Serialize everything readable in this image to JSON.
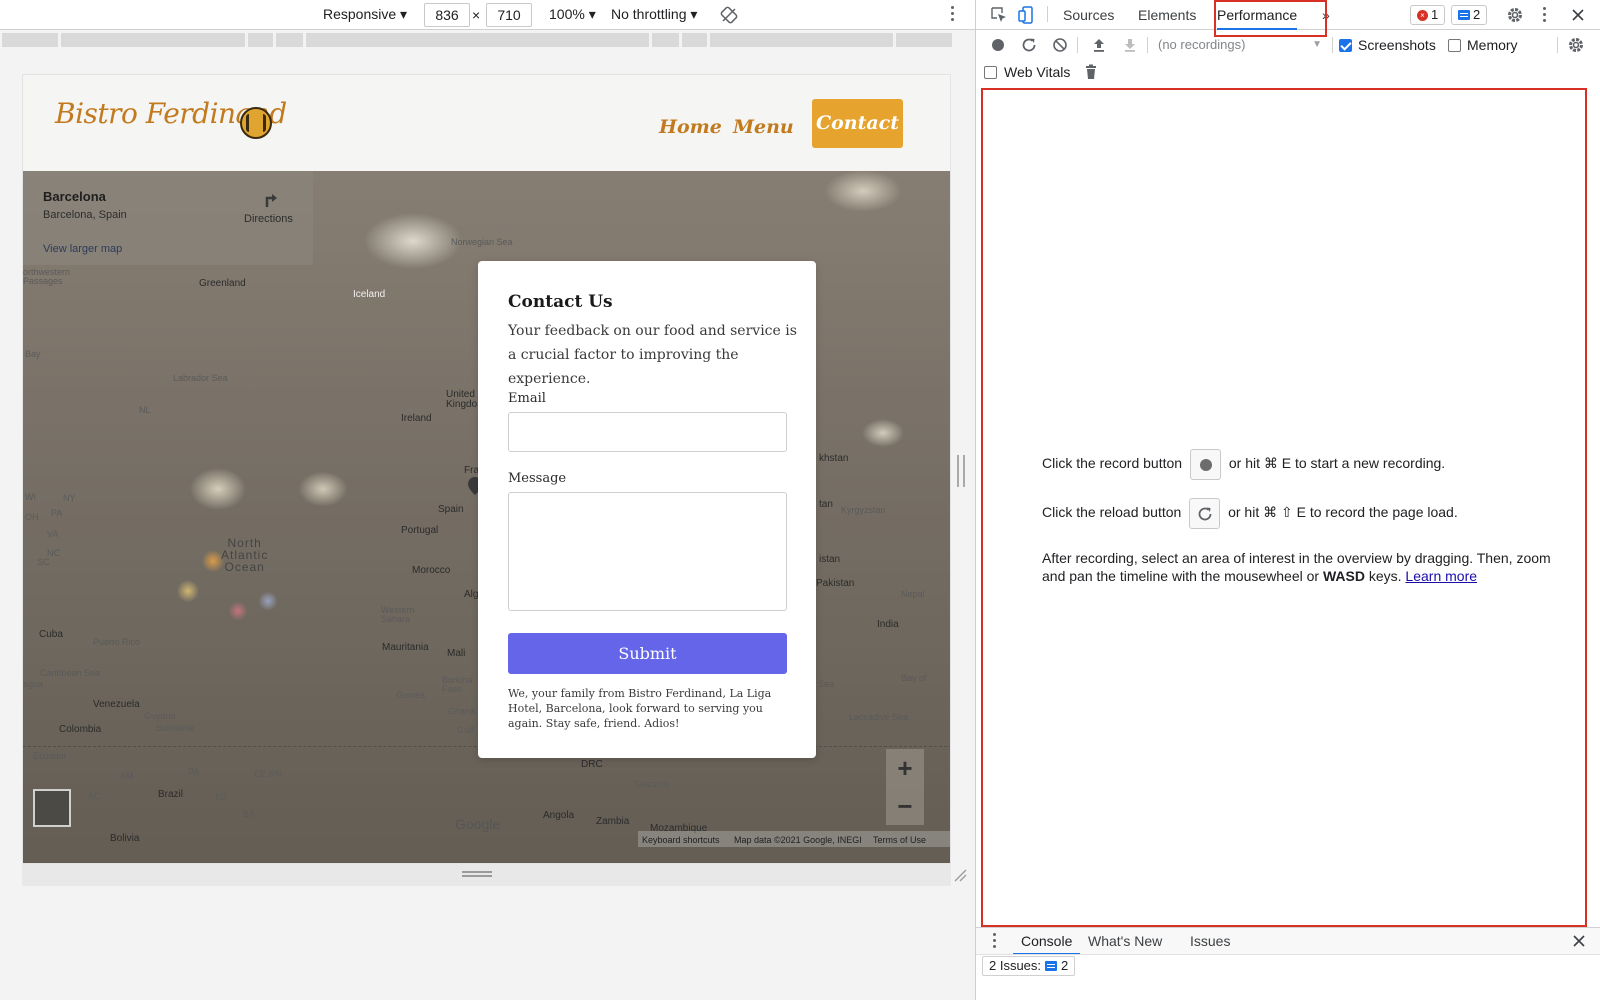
{
  "device_toolbar": {
    "device": "Responsive ▾",
    "width": "836",
    "times": "×",
    "height": "710",
    "zoom": "100% ▾",
    "throttling": "No throttling ▾"
  },
  "site": {
    "logo_text": "Bistro Ferdinand",
    "nav": {
      "home": "Home",
      "menu": "Menu",
      "contact": "Contact"
    },
    "colors": {
      "brand": "#c27a1e",
      "accent": "#e6a32e",
      "submit": "#6465e8"
    }
  },
  "map": {
    "card": {
      "title": "Barcelona",
      "subtitle": "Barcelona, Spain",
      "directions": "Directions",
      "larger_map": "View larger map"
    },
    "labels": {
      "norwegian_sea": "Norwegian Sea",
      "greenland": "Greenland",
      "iceland": "Iceland",
      "northwestern_passages": "orthwestern\nPassages",
      "bay": "Bay",
      "labrador_sea": "Labrador Sea",
      "nl": "NL",
      "ireland": "Ireland",
      "kingdom": "Kingdo",
      "united": "United",
      "fra": "Fra",
      "spain": "Spain",
      "portugal": "Portugal",
      "morocco": "Morocco",
      "alg": "Alg",
      "western_sahara": "Western\nSahara",
      "mauritania": "Mauritania",
      "mali": "Mali",
      "burkina_faso": "Burkina\nFaso",
      "guinea": "Guinea",
      "ghana": "Ghana",
      "gulf": "Gulf",
      "north_atlantic_ocean": "North\nAtlantic\nOcean",
      "cuba": "Cuba",
      "puerto_rico": "Puerto Rico",
      "caribbean_sea": "Caribbean Sea",
      "agua": "agua",
      "venezuela": "Venezuela",
      "guyana": "Guyana",
      "suriname": "Suriname",
      "colombia": "Colombia",
      "ecuador": "Ecuador",
      "brazil": "Brazil",
      "bolivia": "Bolivia",
      "drc": "DRC",
      "tanzania": "Tanzania",
      "angola": "Angola",
      "zambia": "Zambia",
      "mozambique": "Mozambique",
      "khstan": "khstan",
      "tan": "tan",
      "kyrgyzstan": "Kyrgyzstan",
      "istan": "istan",
      "pakistan": "Pakistan",
      "nepal": "Nepal",
      "india": "India",
      "sea": "Sea",
      "bay_of": "Bay of",
      "laccadive_sea": "Laccadive Sea",
      "ny": "NY",
      "pa": "PA",
      "oh": "OH",
      "va": "VA",
      "nc": "NC",
      "wi": "WI",
      "sc": "SC",
      "am": "AM",
      "ac": "AC",
      "pa2": "PA",
      "ce": "CE",
      "rn": "RN",
      "to": "TO",
      "ba": "BA"
    },
    "google": "Google",
    "attribution": {
      "shortcuts": "Keyboard shortcuts",
      "data": "Map data ©2021 Google, INEGI",
      "terms": "Terms of Use"
    },
    "zoom_in": "+",
    "zoom_out": "−"
  },
  "form": {
    "title": "Contact Us",
    "description": "Your feedback on our food and service is a crucial factor to improving the experience.",
    "email_label": "Email",
    "email_value": "",
    "message_label": "Message",
    "message_value": "",
    "submit": "Submit",
    "footer": "We, your family from Bistro Ferdinand, La Liga Hotel, Barcelona, look forward to serving you again. Stay safe, friend. Adios!"
  },
  "devtools": {
    "tabs": {
      "sources": "Sources",
      "elements": "Elements",
      "performance": "Performance",
      "more": "»"
    },
    "errors": "1",
    "messages": "2",
    "recordings": "(no recordings)",
    "screenshots_label": "Screenshots",
    "screenshots_checked": true,
    "memory_label": "Memory",
    "memory_checked": false,
    "web_vitals_label": "Web Vitals",
    "web_vitals_checked": false,
    "landing": {
      "line1_pre": "Click the record button",
      "line1_post": "or hit ⌘ E to start a new recording.",
      "line2_pre": "Click the reload button",
      "line2_post": "or hit ⌘ ⇧ E to record the page load.",
      "para_1": "After recording, select an area of interest in the overview by dragging. Then, zoom and pan the timeline with the mousewheel or ",
      "para_bold": "WASD",
      "para_2": " keys. ",
      "learn_more": "Learn more"
    },
    "drawer": {
      "console": "Console",
      "whats_new": "What's New",
      "issues": "Issues",
      "issues_count_label": "2 Issues:",
      "issues_count": "2"
    },
    "colors": {
      "highlight": "#d93025",
      "tab_underline": "#1a73e8"
    }
  }
}
